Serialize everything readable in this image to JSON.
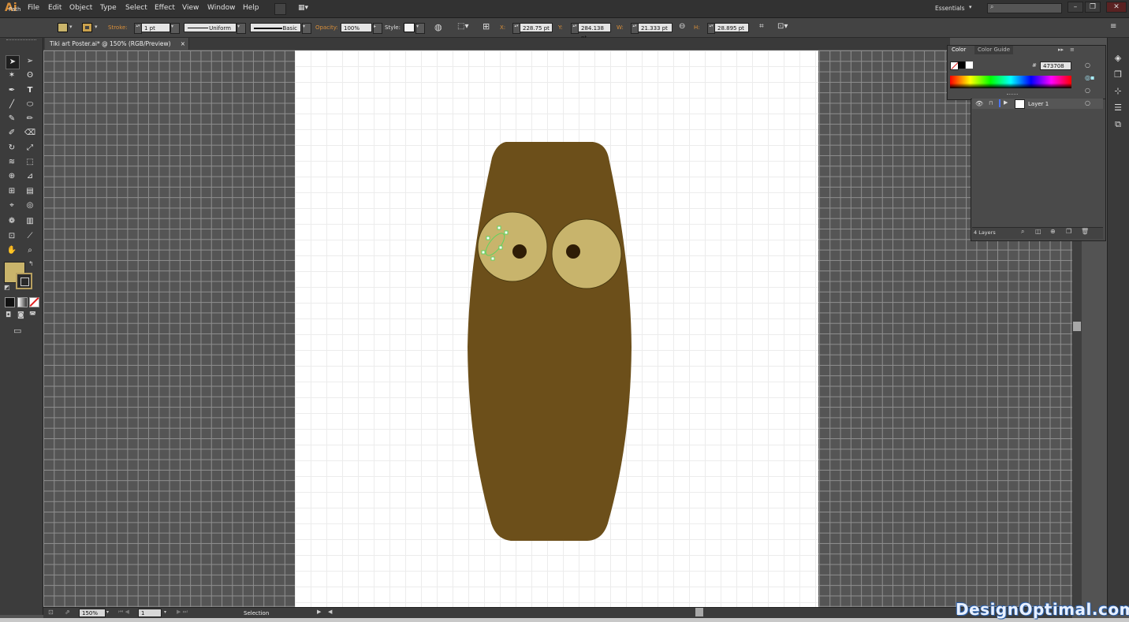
{
  "app": {
    "logo": "Ai",
    "workspace": "Essentials"
  },
  "menu": [
    "File",
    "Edit",
    "Object",
    "Type",
    "Select",
    "Effect",
    "View",
    "Window",
    "Help"
  ],
  "control": {
    "selection_type": "Path",
    "stroke_label": "Stroke:",
    "stroke_weight": "1 pt",
    "profile": "Uniform",
    "brush": "Basic",
    "opacity_label": "Opacity:",
    "opacity": "100%",
    "style_label": "Style:",
    "x_label": "X:",
    "x": "228.75 pt",
    "y_label": "Y:",
    "y": "284.138 pt",
    "w_label": "W:",
    "w": "21.333 pt",
    "h_label": "H:",
    "h": "28.895 pt",
    "fill_color": "#c9b46b",
    "stroke_color": "#3a2a0a"
  },
  "document": {
    "tab_title": "Tiki art Poster.ai* @ 150% (RGB/Preview)",
    "close": "×"
  },
  "color_panel": {
    "tabs": [
      "Color",
      "Color Guide"
    ],
    "hex_label": "#",
    "hex": "473708"
  },
  "layers_panel": {
    "layer_name": "Layer 1",
    "count": "4 Layers"
  },
  "status": {
    "zoom": "150%",
    "artboard": "1",
    "tool": "Selection"
  },
  "artwork": {
    "body_color": "#6c4f1a",
    "eye_color": "#c8b46c",
    "pupil_color": "#2f1d06",
    "selection_color": "#5fd35f"
  },
  "watermark": "DesignOptimal.com"
}
